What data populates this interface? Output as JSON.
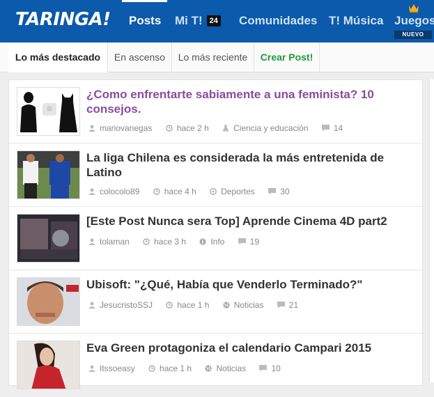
{
  "header": {
    "logo": "TARINGA!",
    "nav": [
      {
        "label": "Posts"
      },
      {
        "label": "Mi T!",
        "badge": "24"
      },
      {
        "label": "Comunidades"
      },
      {
        "label": "T! Música"
      },
      {
        "label": "Juegos",
        "badge": "NUEVO"
      }
    ]
  },
  "subtabs": [
    "Lo más destacado",
    "En ascenso",
    "Lo más reciente",
    "Crear Post!"
  ],
  "posts": [
    {
      "title": "¿Como enfrentarte sabiamente a una feminista? 10 consejos.",
      "author": "mariovanegas",
      "time": "hace 2 h",
      "category": "Ciencia y educación",
      "comments": "14"
    },
    {
      "title": "La liga Chilena es considerada la más entretenida de Latino",
      "author": "colocolo89",
      "time": "hace 4 h",
      "category": "Deportes",
      "comments": "30"
    },
    {
      "title": "[Este Post Nunca sera Top] Aprende Cinema 4D part2",
      "author": "tolaman",
      "time": "hace 3 h",
      "category": "Info",
      "comments": "19"
    },
    {
      "title": "Ubisoft: \"¿Qué, Había que Venderlo Terminado?\"",
      "author": "JesucristoSSJ",
      "time": "hace 1 h",
      "category": "Noticias",
      "comments": "21"
    },
    {
      "title": "Eva Green protagoniza el calendario Campari 2015",
      "author": "Itssoeasy",
      "time": "hace 1 h",
      "category": "Noticias",
      "comments": "10"
    }
  ]
}
